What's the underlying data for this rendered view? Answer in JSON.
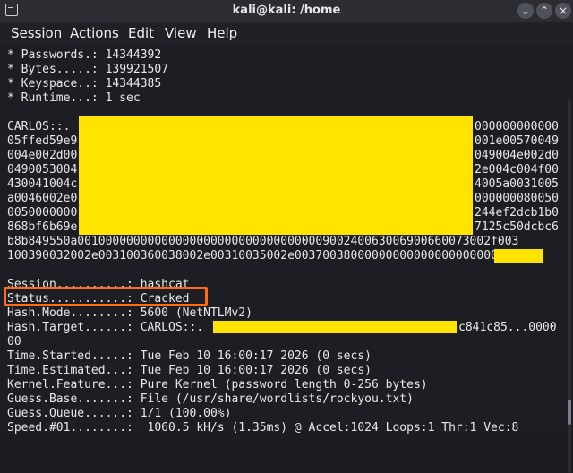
{
  "window": {
    "title": "kali@kali: /home"
  },
  "menu": [
    "Session",
    "Actions",
    "Edit",
    "View",
    "Help"
  ],
  "stats": [
    "* Passwords.: 14344392",
    "* Bytes.....: 139921507",
    "* Keyspace..: 14344385",
    "* Runtime...: 1 sec"
  ],
  "hash_block": {
    "left": [
      "CARLOS::.",
      "05ffed59e9",
      "004e002d00",
      "0490053004",
      "430041004c",
      "a0046002e0",
      "0050000000",
      "868bf6b69e"
    ],
    "right": [
      "000000000000",
      "001e00570049",
      "049004e002d0",
      "2e004c004f00",
      "4005a0031005",
      "000000080050",
      "244ef2dcb1b0",
      "7125c50dcbc6"
    ],
    "full1": "b8b849550a00100000000000000000000000000000000900240063006900660073002f003",
    "full2": "100390032002e003100360038002e00310035002e003700380000000000000000000000:"
  },
  "session": {
    "session_line": "Session..........: hashcat",
    "status_line": "Status...........: Cracked",
    "mode_line": "Hash.Mode........: 5600 (NetNTLMv2)",
    "target_prefix": "Hash.Target......: CARLOS::.",
    "target_suffix": "c841c85...0000",
    "target_wrap": "00",
    "time_started": "Time.Started.....: Tue Feb 10 16:00:17 2026 (0 secs)",
    "time_estimated": "Time.Estimated...: Tue Feb 10 16:00:17 2026 (0 secs)",
    "kernel": "Kernel.Feature...: Pure Kernel (password length 0-256 bytes)",
    "guess_base": "Guess.Base.......: File (/usr/share/wordlists/rockyou.txt)",
    "guess_queue": "Guess.Queue......: 1/1 (100.00%)",
    "speed": "Speed.#01........:  1060.5 kH/s (1.35ms) @ Accel:1024 Loops:1 Thr:1 Vec:8"
  },
  "colors": {
    "redaction": "#ffe400",
    "highlight": "#ff6a13"
  }
}
